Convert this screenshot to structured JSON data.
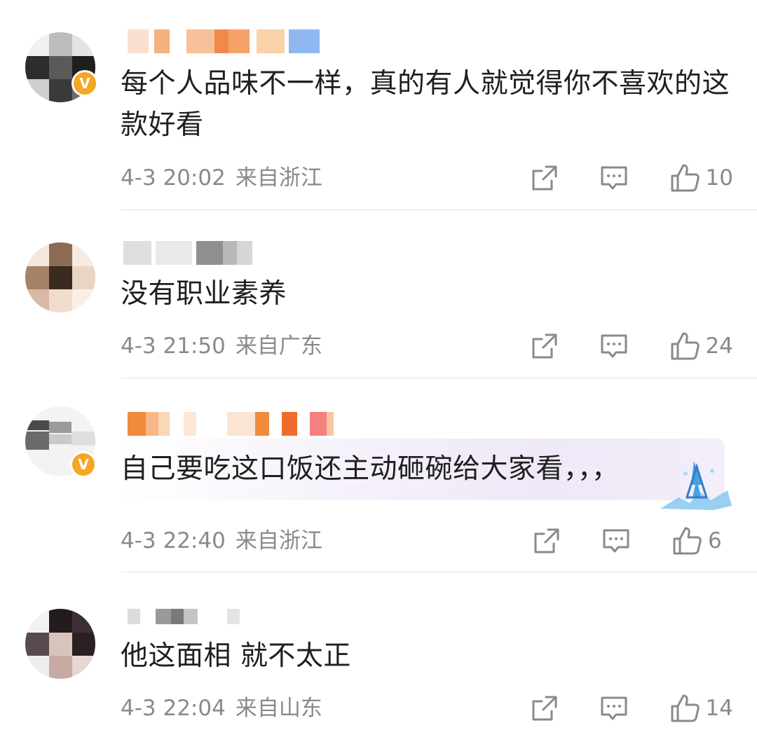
{
  "comments": [
    {
      "text": "每个人品味不一样，真的有人就觉得你不喜欢的这款好看",
      "date": "4-3 20:02",
      "location": "来自浙江",
      "likes": "10",
      "avatar_icon": "pixelated-avatar",
      "verified": true
    },
    {
      "text": "没有职业素养",
      "date": "4-3 21:50",
      "location": "来自广东",
      "likes": "24",
      "avatar_icon": "pixelated-avatar",
      "verified": false
    },
    {
      "text": "自己要吃这口饭还主动砸碗给大家看，，，",
      "date": "4-3 22:40",
      "location": "来自浙江",
      "likes": "6",
      "avatar_icon": "pixelated-avatar",
      "verified": true
    },
    {
      "text": "他这面相 就不太正",
      "date": "4-3 22:04",
      "location": "来自山东",
      "likes": "14",
      "avatar_icon": "pixelated-avatar",
      "verified": false
    }
  ],
  "icons": {
    "share": "share-icon",
    "comment": "comment-icon",
    "like": "thumbs-up-icon"
  },
  "colors": {
    "text": "#1f1f1f",
    "meta": "#8a8a8a",
    "icon": "#8a8a8a",
    "divider": "#e6e6e6",
    "verified_badge": "#f5a623"
  }
}
